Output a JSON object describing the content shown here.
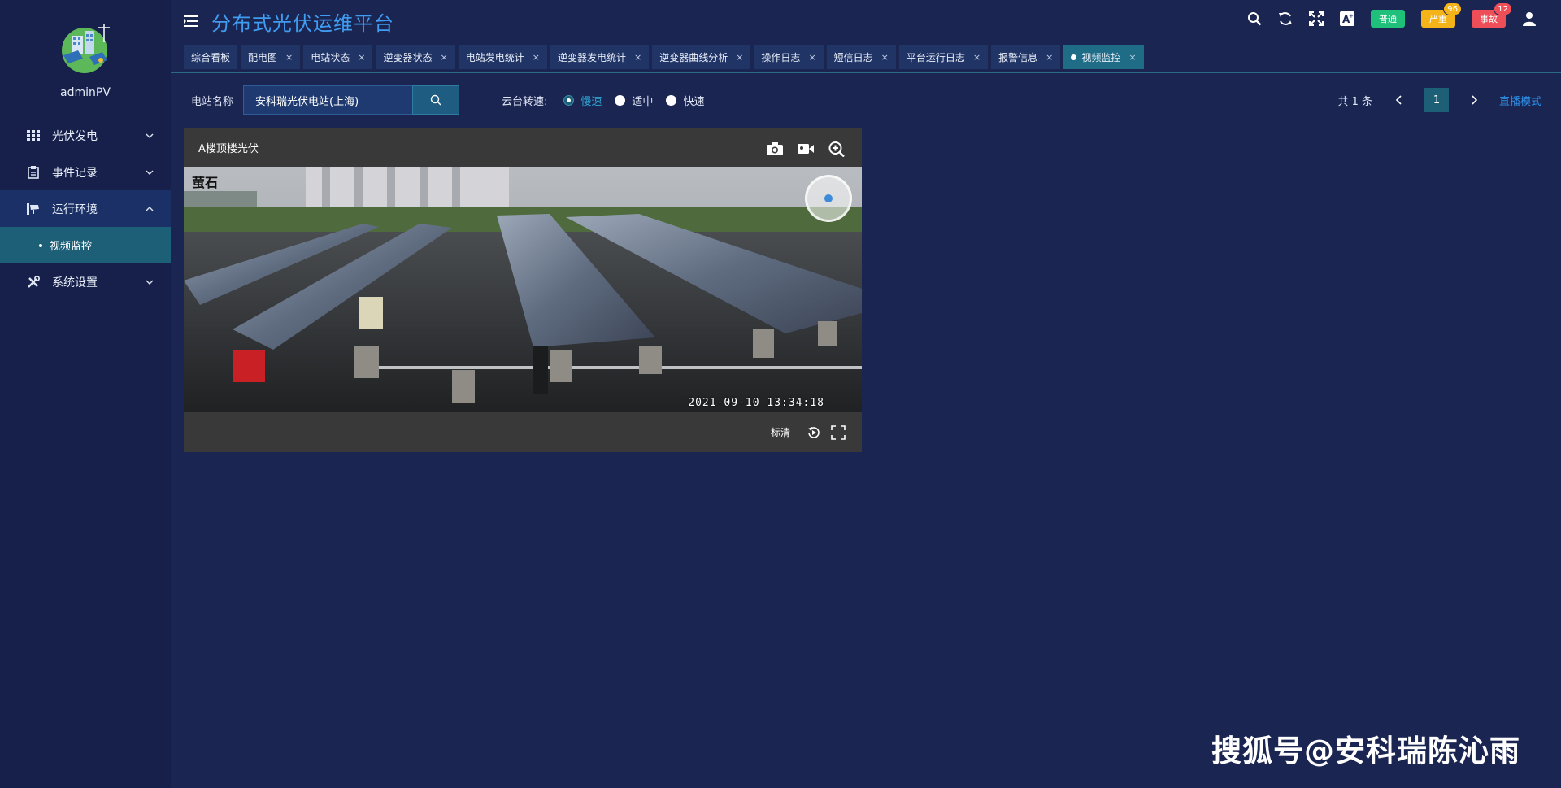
{
  "sidebar": {
    "username": "adminPV",
    "items": [
      {
        "label": "光伏发电",
        "icon": "grid-icon"
      },
      {
        "label": "事件记录",
        "icon": "clipboard-icon"
      },
      {
        "label": "运行环境",
        "icon": "cctv-icon"
      },
      {
        "label": "系统设置",
        "icon": "tools-icon"
      }
    ],
    "submenu": [
      {
        "label": "视频监控"
      }
    ]
  },
  "header": {
    "title": "分布式光伏运维平台",
    "alerts": {
      "normal": {
        "label": "普通"
      },
      "serious": {
        "label": "严重",
        "count": "96"
      },
      "accident": {
        "label": "事故",
        "count": "12"
      }
    }
  },
  "tabs": [
    {
      "label": "综合看板"
    },
    {
      "label": "配电图"
    },
    {
      "label": "电站状态"
    },
    {
      "label": "逆变器状态"
    },
    {
      "label": "电站发电统计"
    },
    {
      "label": "逆变器发电统计"
    },
    {
      "label": "逆变器曲线分析"
    },
    {
      "label": "操作日志"
    },
    {
      "label": "短信日志"
    },
    {
      "label": "平台运行日志"
    },
    {
      "label": "报警信息"
    },
    {
      "label": "视频监控"
    }
  ],
  "toolbar": {
    "station_label": "电站名称",
    "station_value": "安科瑞光伏电站(上海)",
    "speed_label": "云台转速:",
    "speed_options": [
      "慢速",
      "适中",
      "快速"
    ],
    "speed_selected": "慢速",
    "total_text": "共 1 条",
    "current_page": "1",
    "mode_link": "直播模式"
  },
  "video": {
    "title": "A楼顶楼光伏",
    "timestamp": "2021-09-10  13:34:18",
    "cam_brand": "萤石",
    "quality": "标清"
  },
  "watermark": "搜狐号@安科瑞陈沁雨",
  "colors": {
    "bg": "#1b2552",
    "sidebar": "#16204a",
    "accent": "#3f9cf0",
    "active_tab": "#1e6c86",
    "normal": "#1fc07a",
    "serious": "#f5b31a",
    "accident": "#ee4e57"
  }
}
